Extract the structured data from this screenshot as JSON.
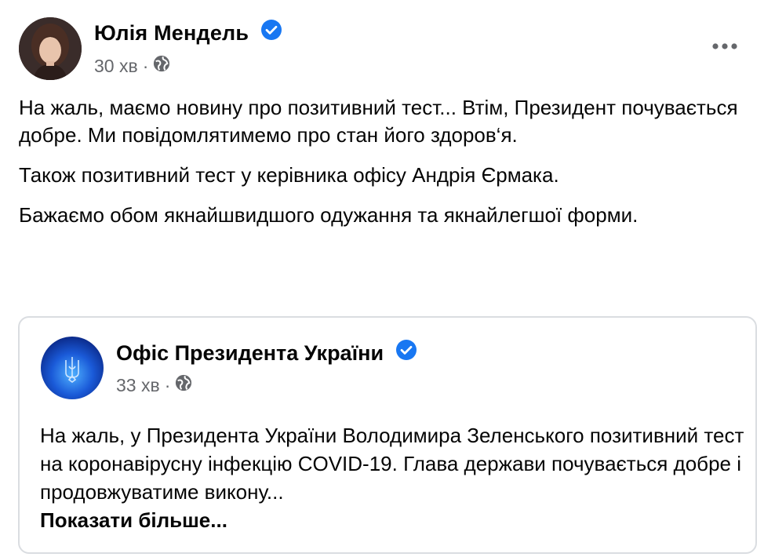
{
  "post": {
    "author": "Юлія Мендель",
    "time": "30 хв",
    "separator": "·",
    "paragraphs": [
      "На жаль, маємо новину про позитивний тест... Втім, Президент почувається добре. Ми повідомлятимемо про стан його здоров‘я.",
      "Також позитивний тест у керівника офісу Андрія Єрмака.",
      "Бажаємо обом якнайшвидшого одужання та якнайлегшої форми."
    ]
  },
  "shared": {
    "author": "Офіс Президента України",
    "time": "33 хв",
    "separator": "·",
    "text": "На жаль, у Президента України Володимира Зеленського позитивний тест на коронавірусну інфекцію COVID-19. Глава держави почувається добре і продовжуватиме викону...",
    "see_more": "Показати більше..."
  },
  "colors": {
    "verified": "#1877f2",
    "secondary_text": "#65676b",
    "card_border": "#dadde1"
  },
  "icons": {
    "verified": "verified-badge-icon",
    "audience": "globe-icon",
    "more": "more-options-icon"
  }
}
